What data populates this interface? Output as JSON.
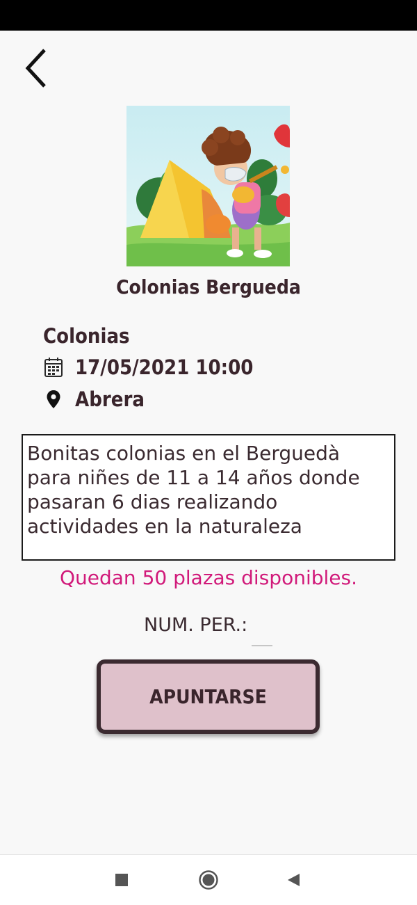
{
  "app": {
    "accent_color": "#dfc1cb",
    "text_color": "#3a252c",
    "highlight_color": "#d11a7a"
  },
  "header": {
    "back_icon": "chevron-left-icon"
  },
  "activity": {
    "image": "child-with-ukulele-and-tent-illustration",
    "title": "Colonias Bergueda",
    "category": "Colonias",
    "date_icon": "calendar-icon",
    "datetime": "17/05/2021 10:00",
    "location_icon": "location-pin-icon",
    "location": "Abrera",
    "description": "Bonitas colonias en el Berguedà para niñes de 11 a 14 años donde pasaran 6 dias realizando actividades en la naturaleza",
    "availability": "Quedan 50 plazas disponibles."
  },
  "form": {
    "num_label": "NUM. PER.:",
    "num_value": "",
    "submit_label": "APUNTARSE"
  },
  "nav": {
    "recents_icon": "square-icon",
    "home_icon": "circle-icon",
    "back_icon": "triangle-back-icon"
  }
}
